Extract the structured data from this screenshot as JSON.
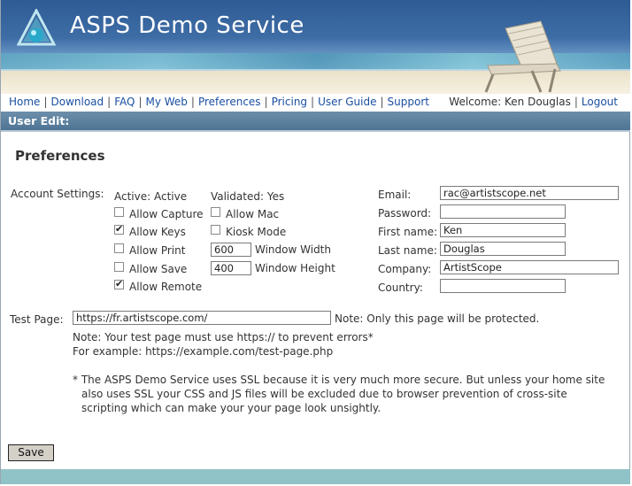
{
  "banner": {
    "title": "ASPS Demo Service"
  },
  "nav": {
    "links": [
      "Home",
      "Download",
      "FAQ",
      "My Web",
      "Preferences",
      "Pricing",
      "User Guide",
      "Support"
    ],
    "welcome": "Welcome: Ken Douglas",
    "logout": "Logout"
  },
  "section": {
    "title": "User Edit:"
  },
  "preferences": {
    "title": "Preferences",
    "account_label": "Account Settings:",
    "active": "Active: Active",
    "validated": "Validated: Yes",
    "allow_capture": "Allow Capture",
    "allow_mac": "Allow Mac",
    "allow_keys": "Allow Keys",
    "kiosk_mode": "Kiosk Mode",
    "allow_print": "Allow Print",
    "window_width_value": "600",
    "window_width_label": "Window Width",
    "allow_save": "Allow Save",
    "window_height_value": "400",
    "window_height_label": "Window Height",
    "allow_remote": "Allow Remote",
    "checked": {
      "allow_capture": false,
      "allow_mac": false,
      "allow_keys": true,
      "kiosk_mode": false,
      "allow_print": false,
      "allow_save": false,
      "allow_remote": true
    }
  },
  "contact": {
    "email_label": "Email:",
    "email_value": "rac@artistscope.net",
    "password_label": "Password:",
    "password_value": "",
    "first_label": "First name:",
    "first_value": "Ken",
    "last_label": "Last name:",
    "last_value": "Douglas",
    "company_label": "Company:",
    "company_value": "ArtistScope",
    "country_label": "Country:",
    "country_value": ""
  },
  "test_page": {
    "label": "Test Page:",
    "value": "https://fr.artistscope.com/",
    "note": "Note: Only this page will be protected.",
    "note2": "Note: Your test page must use https:// to prevent errors*",
    "example": "For example: https://example.com/test-page.php",
    "ssl_1": "* The ASPS Demo Service uses SSL because it is very much more secure. But unless your home site",
    "ssl_2": "also uses SSL your CSS and JS files will be excluded due to browser prevention of cross-site",
    "ssl_3": "scripting which can make your your page look unsightly."
  },
  "save_label": "Save",
  "colors": {
    "banner": "#3e6da6",
    "section_bar": "#5a7f9e",
    "link": "#1a4fa0",
    "footer": "#8fc3c7"
  }
}
